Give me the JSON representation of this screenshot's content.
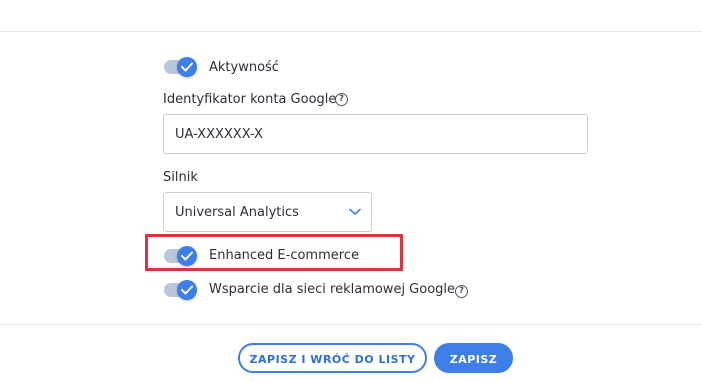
{
  "form": {
    "activity": {
      "label": "Aktywność",
      "enabled": true
    },
    "account_id": {
      "label": "Identyfikator konta Google",
      "help_icon": "question-circle-icon",
      "value": "UA-XXXXXX-X"
    },
    "engine": {
      "label": "Silnik",
      "selected": "Universal Analytics",
      "icon": "chevron-down-icon"
    },
    "enhanced_ecommerce": {
      "label": "Enhanced E-commerce",
      "enabled": true,
      "highlighted": true
    },
    "ad_network_support": {
      "label": "Wsparcie dla sieci reklamowej Google",
      "enabled": true,
      "help_icon": "question-circle-icon"
    }
  },
  "actions": {
    "save_and_back_label": "ZAPISZ I WRÓĆ DO LISTY",
    "save_label": "ZAPISZ"
  },
  "colors": {
    "accent": "#3d7ee8",
    "highlight": "#d7373f",
    "toggle_track": "#b9c6dd"
  }
}
